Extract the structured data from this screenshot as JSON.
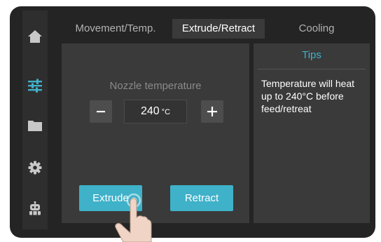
{
  "tabs": [
    {
      "label": "Movement/Temp.",
      "active": false
    },
    {
      "label": "Extrude/Retract",
      "active": true
    },
    {
      "label": "Cooling",
      "active": false
    }
  ],
  "sidebar": {
    "items": [
      {
        "icon": "home-icon"
      },
      {
        "icon": "sliders-icon",
        "active": true
      },
      {
        "icon": "folder-icon"
      },
      {
        "icon": "gear-icon"
      },
      {
        "icon": "robot-icon"
      }
    ]
  },
  "nozzle": {
    "label": "Nozzle temperature",
    "value": "240",
    "unit": "°C",
    "decrement_label": "−",
    "increment_label": "+"
  },
  "actions": {
    "extrude_label": "Extrude",
    "retract_label": "Retract"
  },
  "tips": {
    "title": "Tips",
    "body": "Temperature will heat up to 240°C before feed/retreat"
  },
  "colors": {
    "accent": "#3fb1c9",
    "background": "#242424",
    "panel": "#3a3a3a"
  }
}
